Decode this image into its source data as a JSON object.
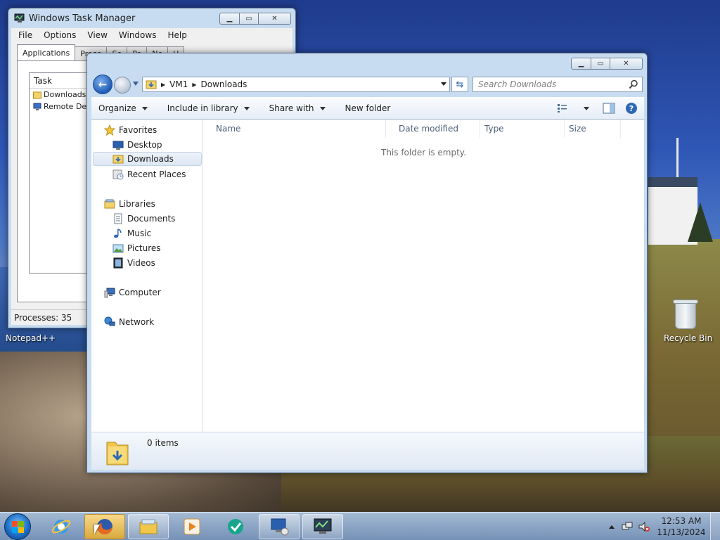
{
  "task_manager": {
    "title": "Windows Task Manager",
    "menu": [
      "File",
      "Options",
      "View",
      "Windows",
      "Help"
    ],
    "tabs": [
      "Applications",
      "Proce",
      "Se",
      "Pe",
      "Ne",
      "U"
    ],
    "active_tab": "Applications",
    "list_header": "Task",
    "tasks": [
      "Downloads",
      "Remote Des"
    ],
    "status": "Processes: 35"
  },
  "explorer": {
    "breadcrumb": [
      "VM1",
      "Downloads"
    ],
    "search_placeholder": "Search Downloads",
    "commands": [
      "Organize",
      "Include in library",
      "Share with",
      "New folder"
    ],
    "nav": {
      "favorites_label": "Favorites",
      "favorites": [
        "Desktop",
        "Downloads",
        "Recent Places"
      ],
      "libraries_label": "Libraries",
      "libraries": [
        "Documents",
        "Music",
        "Pictures",
        "Videos"
      ],
      "computer_label": "Computer",
      "network_label": "Network",
      "selected": "Downloads"
    },
    "columns": [
      "Name",
      "Date modified",
      "Type",
      "Size"
    ],
    "empty_message": "This folder is empty.",
    "item_count": "0 items"
  },
  "desktop": {
    "icons": [
      "Notepad++",
      "Recycle Bin"
    ]
  },
  "taskbar": {
    "time": "12:53 AM",
    "date": "11/13/2024",
    "pinned": [
      "internet-explorer-icon",
      "firefox-icon",
      "windows-explorer-icon",
      "media-player-icon",
      "app-icon",
      "remote-desktop-icon",
      "task-manager-icon"
    ]
  },
  "colors": {
    "accent": "#2d68b5",
    "selection": "#dde7f3",
    "window_frame": "#c7dcf0"
  }
}
